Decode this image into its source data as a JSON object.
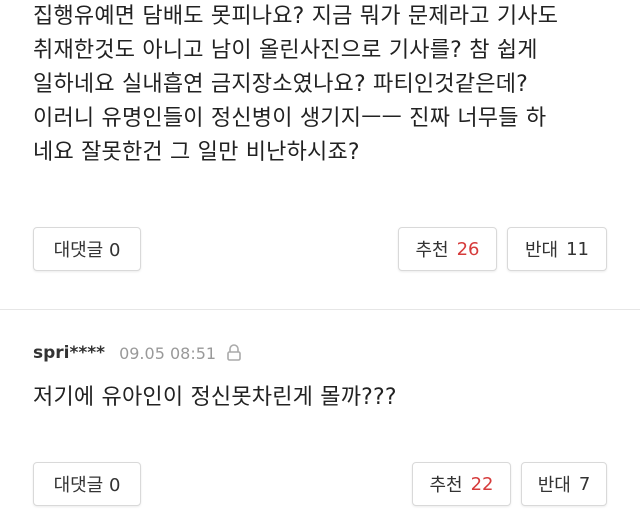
{
  "comments": [
    {
      "text": "집행유예면 담배도 못피나요? 지금 뭐가 문제라고 기사도\n취재한것도 아니고 남이 올린사진으로 기사를? 참 쉽게\n일하네요  실내흡연  금지장소였나요?  파티인것같은데?\n이러니 유명인들이 정신병이 생기지ㅡㅡ 진짜 너무들 하\n네요 잘못한건 그 일만 비난하시죠?",
      "reply_label": "대댓글 0",
      "up_label": "추천",
      "up_count": "26",
      "down_label": "반대",
      "down_count": "11"
    },
    {
      "user": "spri****",
      "time": "09.05 08:51",
      "text": "저기에 유아인이 정신못차린게 몰까???",
      "reply_label": "대댓글 0",
      "up_label": "추천",
      "up_count": "22",
      "down_label": "반대",
      "down_count": "7"
    }
  ],
  "colors": {
    "up_count": "#d63b3b",
    "divider": "#e6e6e6",
    "meta_time": "#999999"
  },
  "icons": {
    "lock": "lock-icon"
  }
}
